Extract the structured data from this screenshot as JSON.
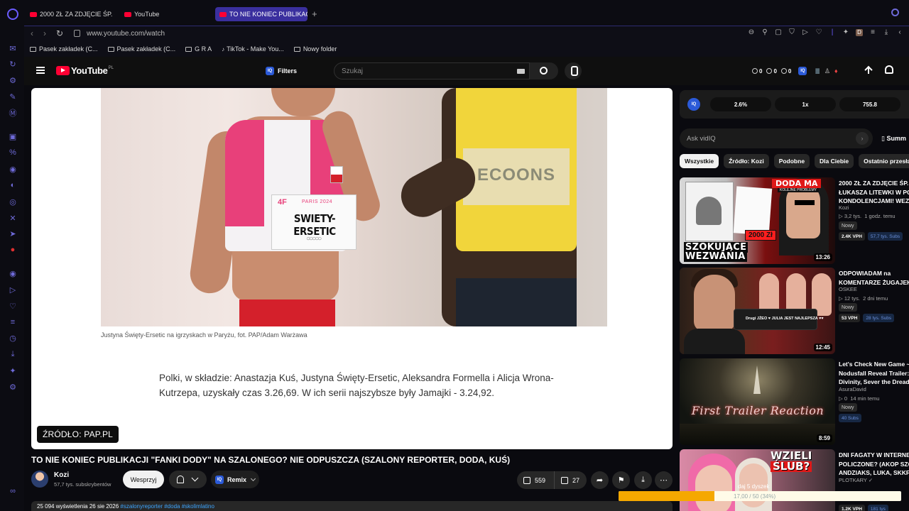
{
  "browser": {
    "tabs": [
      {
        "label": "2000 ZŁ ZA ZDJĘCIE ŚP. Ł"
      },
      {
        "label": "YouTube"
      },
      {
        "label": "TO NIE KONIEC PUBLIKAC"
      }
    ],
    "url": "www.youtube.com/watch",
    "bookmarks": [
      {
        "label": "Pasek zakładek (C..."
      },
      {
        "label": "Pasek zakładek (C..."
      },
      {
        "label": "G R A"
      },
      {
        "label": "TikTok - Make You..."
      },
      {
        "label": "Nowy folder"
      }
    ],
    "profile_initial": "D"
  },
  "youtube": {
    "logo_text": "YouTube",
    "country_code": "PL",
    "filters_label": "Filters",
    "iq_label": "IQ",
    "search_placeholder": "Szukaj",
    "header_stats": [
      "0",
      "0",
      "0"
    ]
  },
  "video": {
    "caption": "Justyna Święty-Ersetic na igrzyskach w Paryżu, fot. PAP/Adam Warżawa",
    "article_text": "Polki, w składzie: Anastazja Kuś, Justyna Święty-Ersetic, Aleksandra Formella i Alicja Wrona-Kutrzepa, uzyskały czas 3.26,69. W ich serii najszybsze były Jamajki - 3.24,92.",
    "source_badge": "ŹRÓDŁO: PAP.PL",
    "bib_brand": "4F",
    "bib_event": "PARIS 2024",
    "bib_name": "SWIETY-ERSETIC",
    "rival_bib": "ECOONS",
    "title": "TO NIE KONIEC PUBLIKACJI \"FANKI DODY\" NA SZALONEGO? NIE ODPUSZCZA (SZALONY REPORTER, DODA, KUŚ)",
    "channel_name": "Kozi",
    "subscribers": "57,7 tys. subskrybentów",
    "support_label": "Wesprzyj",
    "remix_label": "Remix",
    "likes": "559",
    "dislikes": "27",
    "description_start": "25 094 wyświetlenia  26 sie 2026  ",
    "description_tags": "#szalonyreporter #doda #skolimlatino"
  },
  "iq_panel": {
    "stats": [
      "2.6%",
      "1x",
      "755.8"
    ],
    "ask_placeholder": "Ask vidIQ",
    "summary_label": "Summ"
  },
  "chips": [
    "Wszystkie",
    "Źródło: Kozi",
    "Podobne",
    "Dla Ciebie",
    "Ostatnio przesłan"
  ],
  "recommendations": [
    {
      "title_line1": "2000 ZŁ ZA ZDJĘCIE ŚP.",
      "title_line2": "ŁUKASZA LITEWKI W POS",
      "title_line3": "KONDOLENCJAMI! WEZW",
      "channel": "Kozi",
      "views": "3,2 tys.",
      "age": "1 godz. temu",
      "new_label": "Nowy",
      "vph": "2.4K VPH",
      "subs": "57,7 tys. Subs",
      "duration": "13:26",
      "thumb_badge": "DODA MA",
      "thumb_badge_sub": "KOLEJNE PROBLEMY",
      "thumb_price": "2000 Zł",
      "thumb_headline_1": "SZOKUJĄCE",
      "thumb_headline_2": "WEZWANIA"
    },
    {
      "title_line1": "ODPOWIADAM na",
      "title_line2": "KOMENTARZE ŻUGAJEK",
      "channel": "OSKEE",
      "views": "12 tys.",
      "age": "2 dni temu",
      "new_label": "Nowy",
      "vph": "53 VPH",
      "subs": "28 tys. Subs",
      "duration": "12:45",
      "thumb_comment": "Drugi JŻEO ♥ JULIA JEST NAJLEPSZA ♥♥"
    },
    {
      "title_line1": "Let's Check New Game ~",
      "title_line2": "Nodusfall Reveal Trailer: T",
      "title_line3": "Divinity, Sever the Dreadn",
      "channel": "AsuraDavid",
      "views": "0",
      "age": "14 min temu",
      "new_label": "Nowy",
      "subs": "40 Subs",
      "duration": "8:59",
      "thumb_text": "First Trailer Reaction"
    },
    {
      "title_line1": "DNI FAGATY W INTERNEC",
      "title_line2": "POLICZONE? (AKOP SZOS",
      "title_line3": "ANDZIAKS, LUKA, SKKF)",
      "channel": "PLOTKARY",
      "vph": "1.2K VPH",
      "subs": "181 tys",
      "thumb_badge_1": "WZIELI",
      "thumb_badge_2": "ŚLUB?"
    }
  ],
  "mini_player": {
    "label": "daj 5 dyszek",
    "time": "17,00 / 50 (34%)",
    "progress": 0.34,
    "fill_color": "#f5a800"
  },
  "colors": {
    "accent": "#3a2f9e",
    "youtube_red": "#ff0033",
    "iq_blue": "#2b5ad8"
  }
}
